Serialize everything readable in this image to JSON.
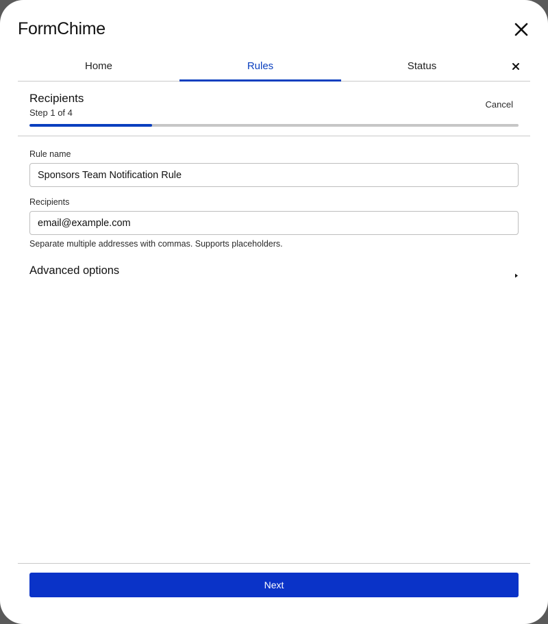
{
  "app": {
    "logo_text": "FormChime"
  },
  "tabs": [
    {
      "label": "Home",
      "active": false
    },
    {
      "label": "Rules",
      "active": true
    },
    {
      "label": "Status",
      "active": false
    }
  ],
  "wizard": {
    "title": "Recipients",
    "step_text": "Step 1 of 4",
    "cancel_label": "Cancel",
    "progress_fraction": 0.25
  },
  "form": {
    "rule_name": {
      "label": "Rule name",
      "value": "Sponsors Team Notification Rule"
    },
    "recipients": {
      "label": "Recipients",
      "value": "email@example.com",
      "helper": "Separate multiple addresses with commas. Supports placeholders."
    },
    "advanced_options_label": "Advanced options"
  },
  "footer": {
    "next_label": "Next"
  },
  "colors": {
    "accent": "#0a3fbf",
    "primary_button": "#0a33c8",
    "divider": "#c9c9c9"
  },
  "icons": {
    "main_close": "close-icon",
    "tabs_close": "close-icon",
    "advanced_toggle": "caret-right-icon"
  }
}
